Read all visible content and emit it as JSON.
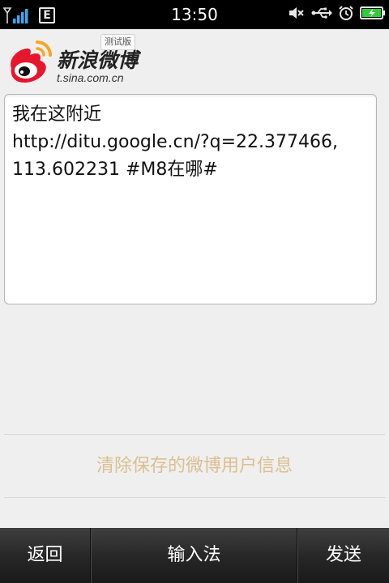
{
  "status_bar": {
    "time": "13:50",
    "network_type": "E",
    "icons": [
      "signal-icon",
      "network-type-icon",
      "mute-icon",
      "usb-icon",
      "alarm-icon",
      "battery-charging-icon"
    ]
  },
  "header": {
    "brand_name": "新浪微博",
    "brand_url": "t.sina.com.cn",
    "beta_badge": "测试版",
    "logo_colors": {
      "red": "#e6162d",
      "orange": "#f5a623"
    }
  },
  "composer": {
    "text": "我在这附近\nhttp://ditu.google.cn/?q=22.377466,\n113.602231 #M8在哪#"
  },
  "actions": {
    "clear_saved_user_info": "清除保存的微博用户信息"
  },
  "bottom_bar": {
    "back": "返回",
    "input_method": "输入法",
    "send": "发送"
  },
  "colors": {
    "background": "#efefef",
    "link_accent": "#dcbf8f",
    "status_bar": "#000000"
  }
}
